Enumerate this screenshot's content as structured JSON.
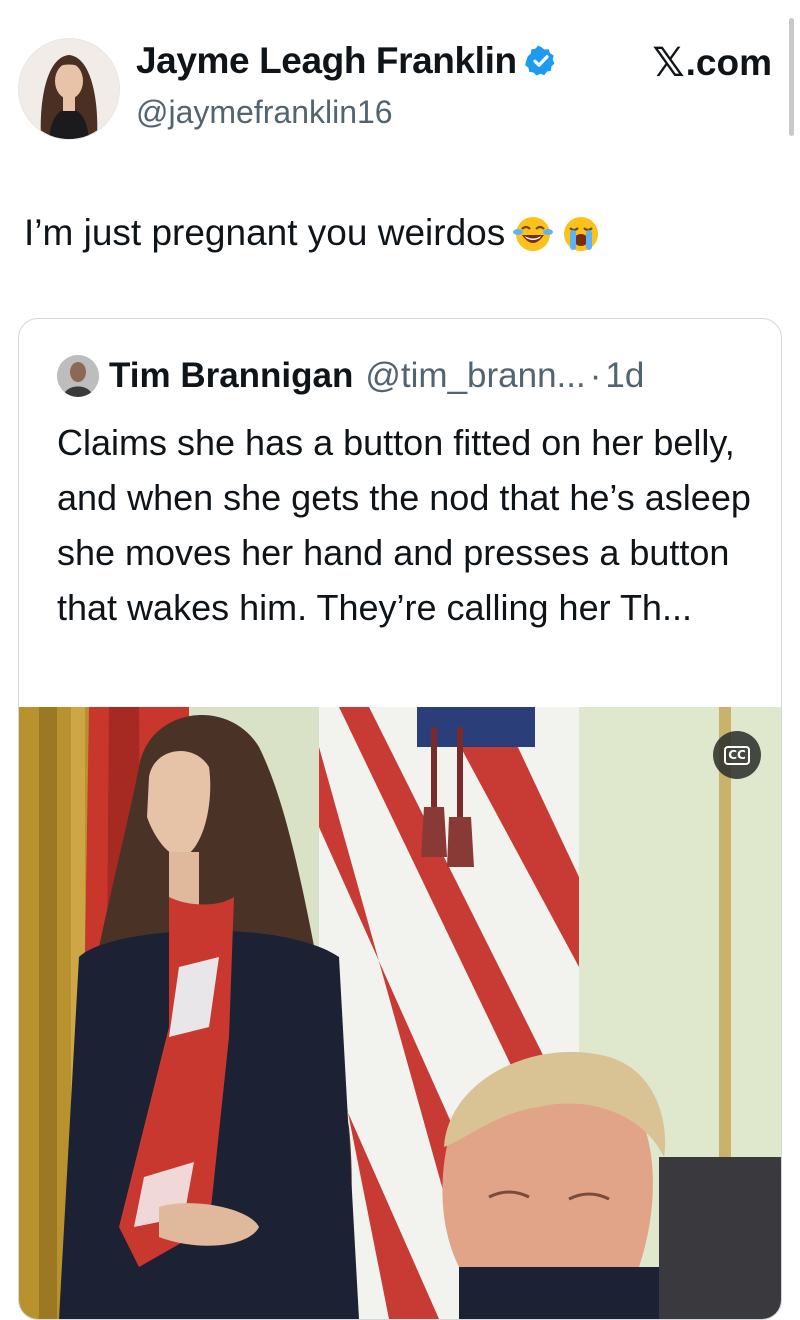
{
  "author": {
    "display_name": "Jayme Leagh Franklin",
    "handle": "@jaymefranklin16",
    "verified_icon": "verified-badge-icon",
    "verified_color": "#1d9bf0"
  },
  "source": {
    "glyph": "𝕏",
    "label": ".com"
  },
  "tweet": {
    "text": "I’m just pregnant you weirdos",
    "emojis": [
      "face-with-tears-of-joy-icon",
      "loudly-crying-face-icon"
    ]
  },
  "quoted_tweet": {
    "display_name": "Tim Brannigan",
    "handle": "@tim_brann...",
    "separator": "·",
    "time": "1d",
    "text": "Claims she has a button fitted on her belly, and when she gets the nod that he’s asleep she moves her hand and presses a button that wakes him. They’re calling her Th...",
    "media": {
      "type": "video",
      "captions_label": "CC"
    }
  },
  "colors": {
    "text": "#0f1419",
    "secondary_text": "#536471",
    "border": "#cfd9de"
  }
}
